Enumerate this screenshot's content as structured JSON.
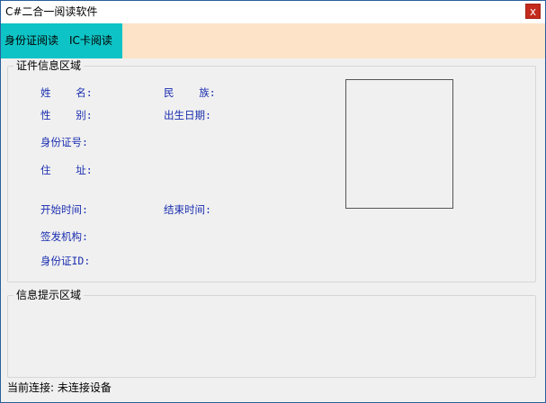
{
  "window": {
    "title": "C#二合一阅读软件",
    "close_symbol": "x"
  },
  "toolbar": {
    "tabs": [
      {
        "label": "身份证阅读"
      },
      {
        "label": "IC卡阅读"
      }
    ],
    "colors": {
      "tabs_background": "#0ec3c5",
      "toolbar_background": "#fde3c7"
    }
  },
  "id_info": {
    "legend": "证件信息区域",
    "name_label": "姓    名:",
    "nation_label": "民    族:",
    "gender_label": "性    别:",
    "birth_label": "出生日期:",
    "id_number_label": "身份证号:",
    "address_label": "住    址:",
    "start_label": "开始时间:",
    "end_label": "结束时间:",
    "issuer_label": "签发机构:",
    "card_id_label": "身份证ID:",
    "label_color": "#1a2eb0"
  },
  "tips": {
    "legend": "信息提示区域"
  },
  "status": {
    "text": "当前连接: 未连接设备"
  }
}
